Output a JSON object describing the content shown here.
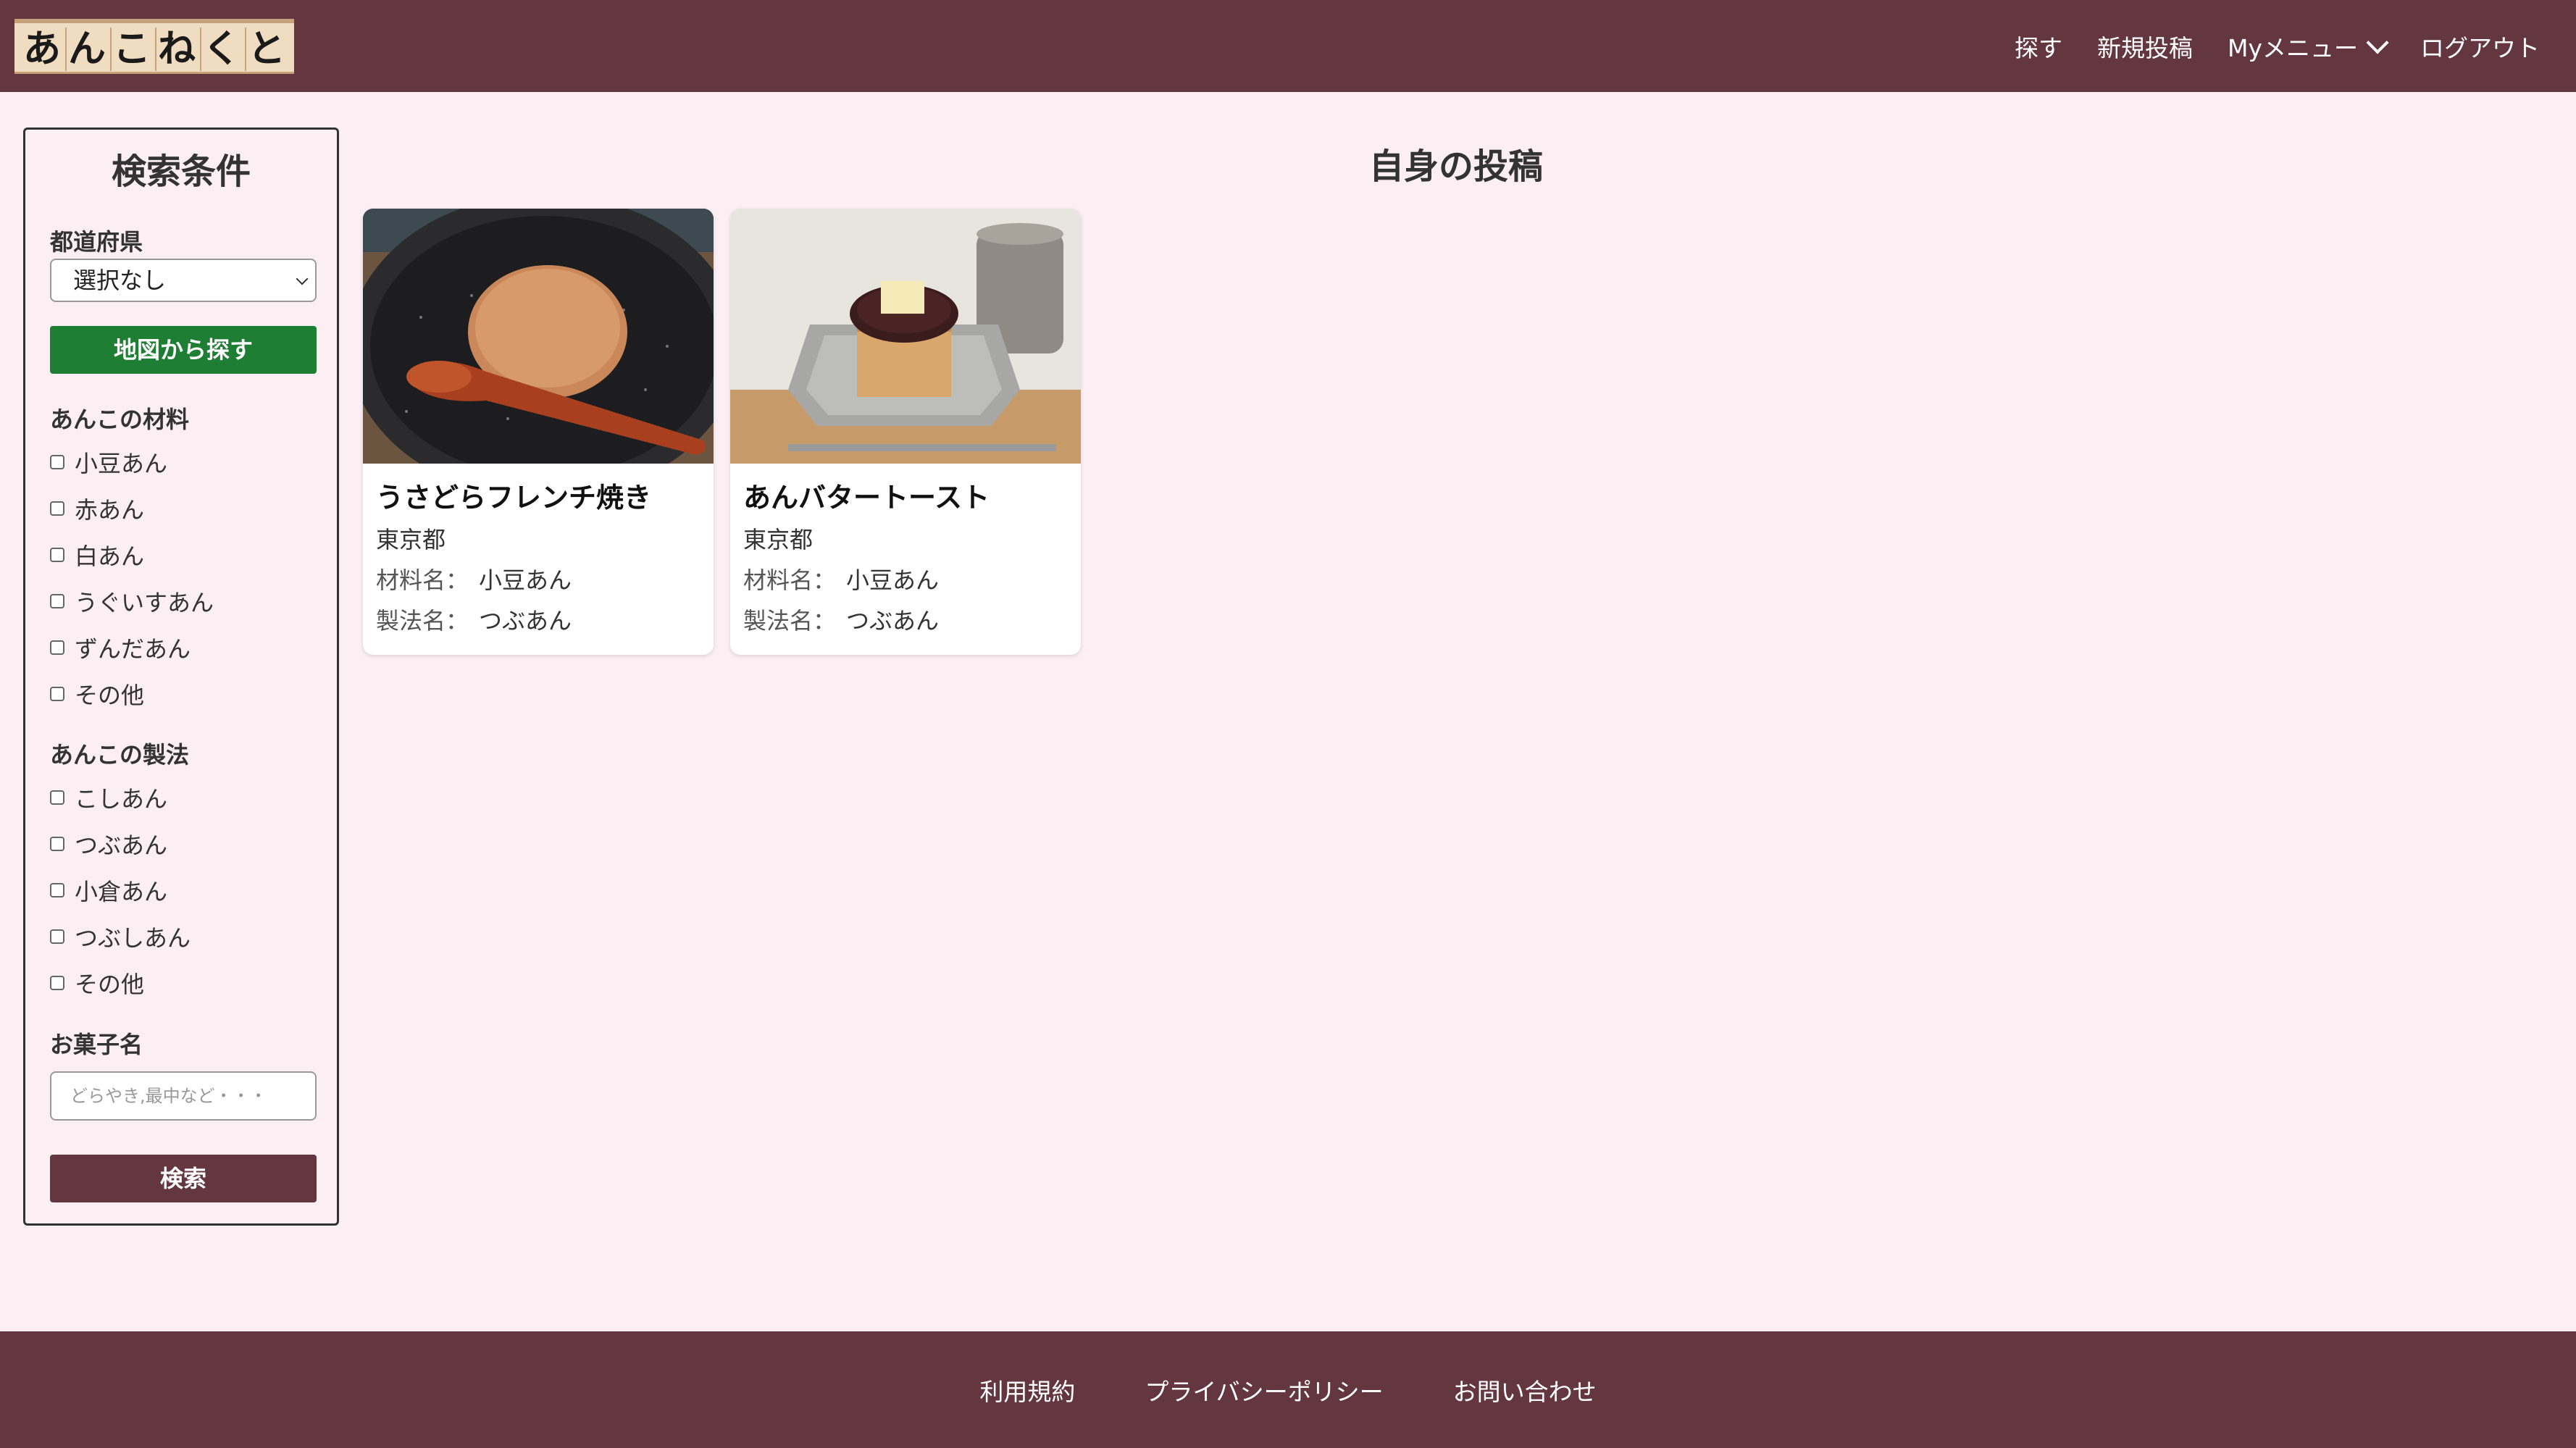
{
  "app": {
    "logo_chars": [
      "あ",
      "ん",
      "こ",
      "ね",
      "く",
      "と"
    ],
    "brand_color": "#633640",
    "background_color": "#fbeff3",
    "accent_green": "#1e7e34"
  },
  "nav": {
    "search": "探す",
    "new_post": "新規投稿",
    "my_menu": "Myメニュー",
    "logout": "ログアウト"
  },
  "sidebar": {
    "title": "検索条件",
    "prefecture_label": "都道府県",
    "prefecture_value": "選択なし",
    "map_button": "地図から探す",
    "materials_label": "あんこの材料",
    "materials": [
      "小豆あん",
      "赤あん",
      "白あん",
      "うぐいすあん",
      "ずんだあん",
      "その他"
    ],
    "methods_label": "あんこの製法",
    "methods": [
      "こしあん",
      "つぶあん",
      "小倉あん",
      "つぶしあん",
      "その他"
    ],
    "sweet_name_label": "お菓子名",
    "sweet_name_placeholder": "どらやき,最中など・・・",
    "search_button": "検索"
  },
  "main": {
    "title": "自身の投稿",
    "cards": [
      {
        "title": "うさどらフレンチ焼き",
        "prefecture": "東京都",
        "material_label": "材料名：",
        "material": "小豆あん",
        "method_label": "製法名：",
        "method": "つぶあん",
        "image_icon": "dorayaki-plate-photo"
      },
      {
        "title": "あんバタートースト",
        "prefecture": "東京都",
        "material_label": "材料名：",
        "material": "小豆あん",
        "method_label": "製法名：",
        "method": "つぶあん",
        "image_icon": "anko-butter-toast-photo"
      }
    ]
  },
  "footer": {
    "terms": "利用規約",
    "privacy": "プライバシーポリシー",
    "contact": "お問い合わせ"
  }
}
